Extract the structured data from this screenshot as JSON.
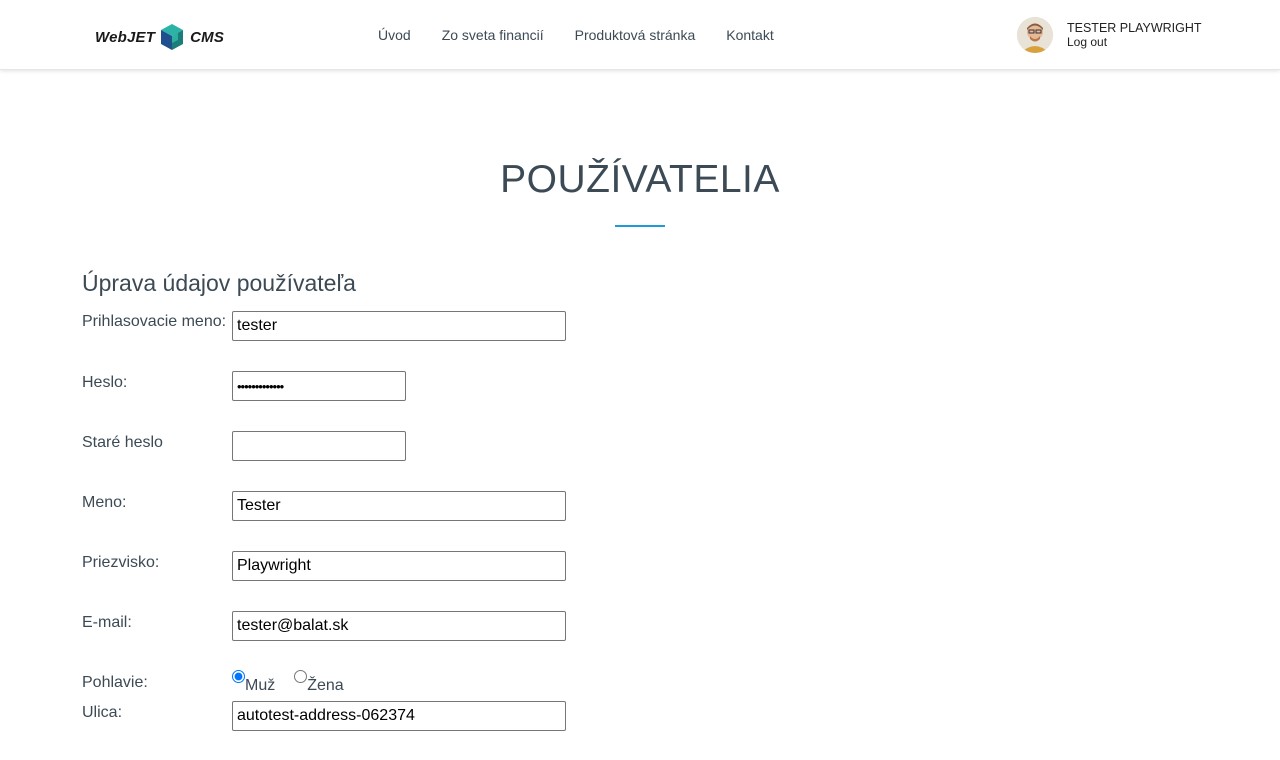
{
  "header": {
    "logo": {
      "text_left": "WebJET",
      "text_right": "CMS"
    },
    "nav": [
      "Úvod",
      "Zo sveta financií",
      "Produktová stránka",
      "Kontakt"
    ],
    "user": {
      "name": "TESTER PLAYWRIGHT",
      "logout": "Log out"
    }
  },
  "page": {
    "title": "POUŽÍVATELIA",
    "section_title": "Úprava údajov používateľa"
  },
  "form": {
    "login": {
      "label": "Prihlasovacie meno:",
      "value": "tester"
    },
    "password": {
      "label": "Heslo:",
      "value": "•••••••••••••"
    },
    "old_password": {
      "label": "Staré heslo",
      "value": ""
    },
    "first_name": {
      "label": "Meno:",
      "value": "Tester"
    },
    "last_name": {
      "label": "Priezvisko:",
      "value": "Playwright"
    },
    "email": {
      "label": "E-mail:",
      "value": "tester@balat.sk"
    },
    "gender": {
      "label": "Pohlavie:",
      "options": [
        "Muž",
        "Žena"
      ],
      "selected": "Muž"
    },
    "street": {
      "label": "Ulica:",
      "value": "autotest-address-062374"
    }
  },
  "colors": {
    "accent": "#1e9cd7",
    "text": "#3c4a55"
  }
}
